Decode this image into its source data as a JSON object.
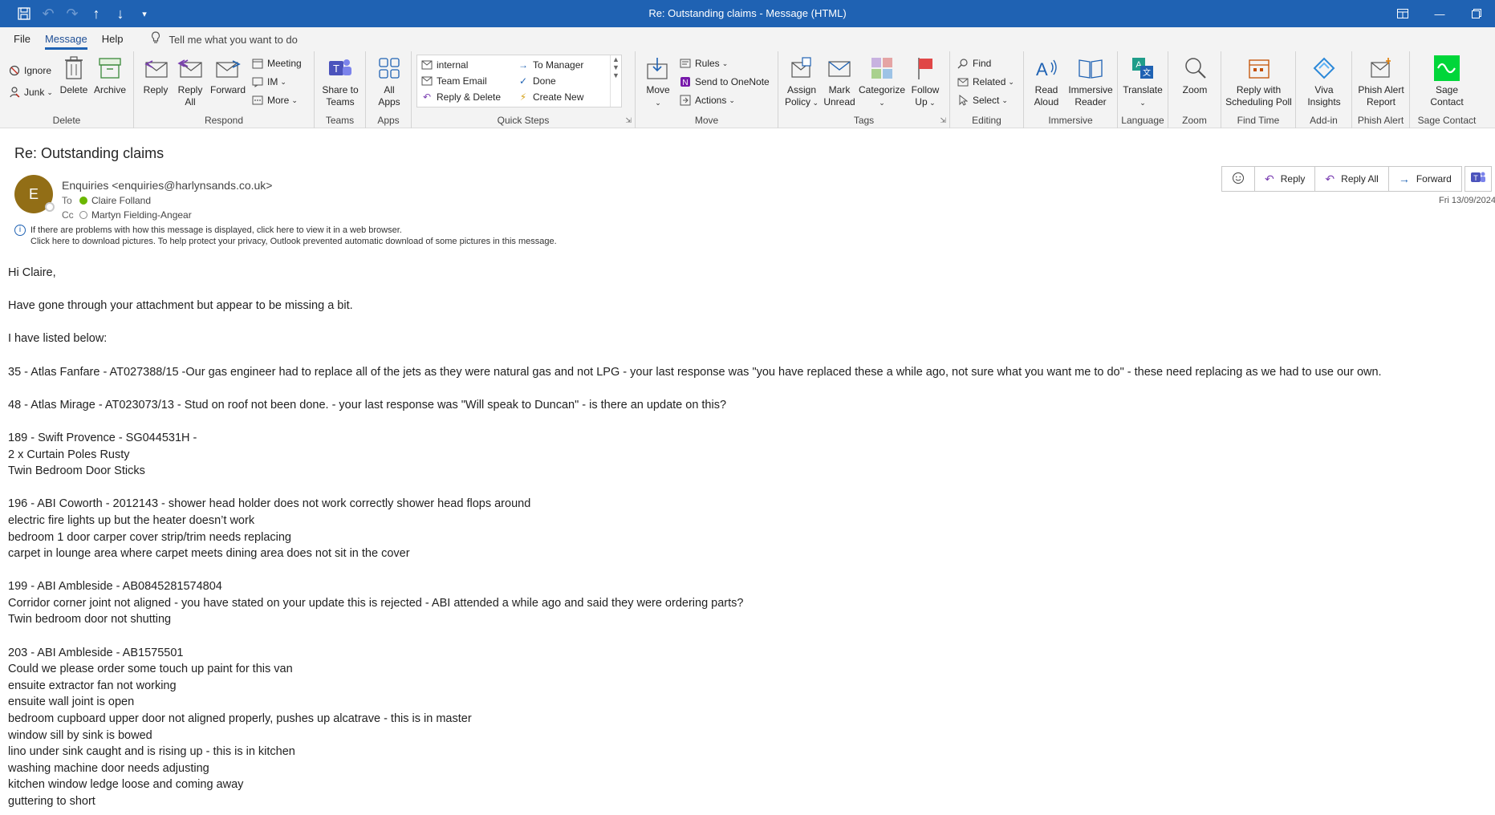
{
  "window": {
    "title": "Re: Outstanding claims  -  Message (HTML)"
  },
  "menu": {
    "tabs": [
      "File",
      "Message",
      "Help"
    ],
    "tell_me": "Tell me what you want to do"
  },
  "ribbon": {
    "delete_group": {
      "label": "Delete",
      "ignore": "Ignore",
      "junk": "Junk",
      "delete": "Delete",
      "archive": "Archive"
    },
    "respond_group": {
      "label": "Respond",
      "reply": "Reply",
      "reply_all_1": "Reply",
      "reply_all_2": "All",
      "forward": "Forward",
      "meeting": "Meeting",
      "im": "IM",
      "more": "More"
    },
    "teams_group": {
      "label": "Teams",
      "share_1": "Share to",
      "share_2": "Teams"
    },
    "apps_group": {
      "label": "Apps",
      "all_1": "All",
      "all_2": "Apps"
    },
    "quick_steps_group": {
      "label": "Quick Steps",
      "items": [
        "internal",
        "Team Email",
        "Reply & Delete",
        "To Manager",
        "Done",
        "Create New"
      ]
    },
    "move_group": {
      "label": "Move",
      "move": "Move",
      "rules": "Rules",
      "onenote": "Send to OneNote",
      "actions": "Actions"
    },
    "tags_group": {
      "label": "Tags",
      "assign_1": "Assign",
      "assign_2": "Policy",
      "mark_1": "Mark",
      "mark_2": "Unread",
      "categorize": "Categorize",
      "follow_1": "Follow",
      "follow_2": "Up"
    },
    "editing_group": {
      "label": "Editing",
      "find": "Find",
      "related": "Related",
      "select": "Select"
    },
    "immersive_group": {
      "label": "Immersive",
      "read_1": "Read",
      "read_2": "Aloud",
      "reader_1": "Immersive",
      "reader_2": "Reader"
    },
    "language_group": {
      "label": "Language",
      "translate": "Translate"
    },
    "zoom_group": {
      "label": "Zoom",
      "zoom": "Zoom"
    },
    "findtime_group": {
      "label": "Find Time",
      "poll_1": "Reply with",
      "poll_2": "Scheduling Poll"
    },
    "addin_group": {
      "label": "Add-in",
      "viva_1": "Viva",
      "viva_2": "Insights"
    },
    "phish_group": {
      "label": "Phish Alert",
      "phish_1": "Phish Alert",
      "phish_2": "Report"
    },
    "sage_group": {
      "label": "Sage Contact",
      "sage_1": "Sage",
      "sage_2": "Contact"
    }
  },
  "message": {
    "subject": "Re: Outstanding claims",
    "avatar_initial": "E",
    "sender": "Enquiries <enquiries@harlynsands.co.uk>",
    "to_label": "To",
    "to": "Claire Folland",
    "cc_label": "Cc",
    "cc": "Martyn Fielding-Angear",
    "info_line_1": "If there are problems with how this message is displayed, click here to view it in a web browser.",
    "info_line_2": "Click here to download pictures. To help protect your privacy, Outlook prevented automatic download of some pictures in this message.",
    "date": "Fri 13/09/2024",
    "actions": {
      "reply": "Reply",
      "reply_all": "Reply All",
      "forward": "Forward"
    }
  },
  "body_lines": [
    "Hi Claire,",
    "",
    "Have gone through your attachment but appear to be missing a bit.",
    "",
    "I have listed below:",
    "",
    "35 - Atlas Fanfare - AT027388/15 -Our gas engineer had to replace all of the jets as they were natural gas and not LPG - your last response was \"you have replaced these a while ago, not sure what you want me to do\" - these need replacing as we had to use our own.",
    "",
    "48 - Atlas Mirage - AT023073/13 - Stud on roof not been done. - your last response was \"Will speak to Duncan\" - is there an update on this?",
    "",
    "189 - Swift Provence - SG044531H -",
    "2 x Curtain Poles Rusty",
    "Twin Bedroom Door Sticks",
    "",
    "196 - ABI Coworth - 2012143 - shower head holder does not work correctly shower head flops around",
    "electric fire lights up but the heater doesn’t work",
    "bedroom 1 door carper cover strip/trim needs replacing",
    "carpet in lounge area where carpet meets dining area does not sit in the cover",
    "",
    "199 - ABI Ambleside  - AB0845281574804",
    "Corridor corner joint not aligned - you have stated on your update this is rejected -  ABI attended a while ago and said they were ordering parts?",
    "Twin bedroom door not shutting",
    "",
    "203 - ABI Ambleside - AB1575501",
    "Could we please order some touch up paint for this van",
    "ensuite extractor fan not working",
    "ensuite wall joint is open",
    "bedroom cupboard upper door not aligned properly, pushes up alcatrave - this is in master",
    "window sill by sink is bowed",
    "lino under sink caught and is rising up - this is in kitchen",
    "washing machine door needs adjusting",
    "kitchen window ledge loose and coming away",
    "guttering to short"
  ]
}
